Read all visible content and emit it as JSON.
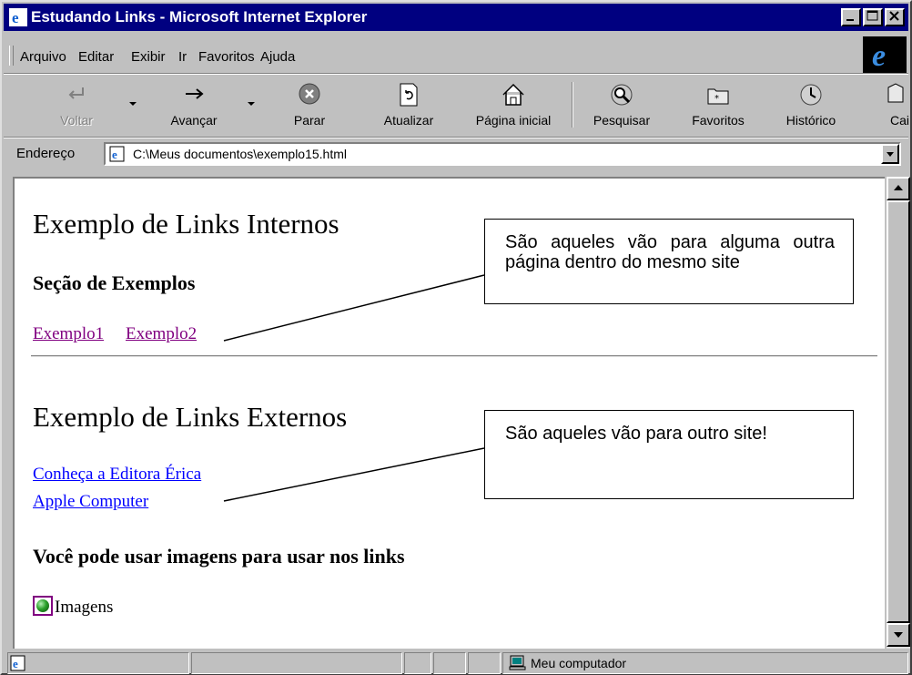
{
  "window": {
    "title": "Estudando Links - Microsoft Internet Explorer"
  },
  "menu": [
    "Arquivo",
    "Editar",
    "Exibir",
    "Ir",
    "Favoritos",
    "Ajuda"
  ],
  "toolbar": {
    "back": "Voltar",
    "forward": "Avançar",
    "stop": "Parar",
    "refresh": "Atualizar",
    "home": "Página inicial",
    "search": "Pesquisar",
    "favorites": "Favoritos",
    "history": "Histórico",
    "mail": "Cai"
  },
  "address": {
    "label": "Endereço",
    "url": "C:\\Meus documentos\\exemplo15.html"
  },
  "page": {
    "heading_internal": "Exemplo de Links Internos",
    "section_examples": "Seção de Exemplos",
    "link_ex1": "Exemplo1",
    "link_ex2": "Exemplo2",
    "heading_external": "Exemplo de Links Externos",
    "link_erica": "Conheça a Editora Érica",
    "link_apple": "Apple Computer",
    "images_heading": "Você pode usar imagens para usar nos links",
    "images_text": "Imagens",
    "callout_internal": "São aqueles vão para alguma outra página dentro do mesmo site",
    "callout_external": "São aqueles vão para outro site!"
  },
  "status": {
    "zone": "Meu computador"
  }
}
